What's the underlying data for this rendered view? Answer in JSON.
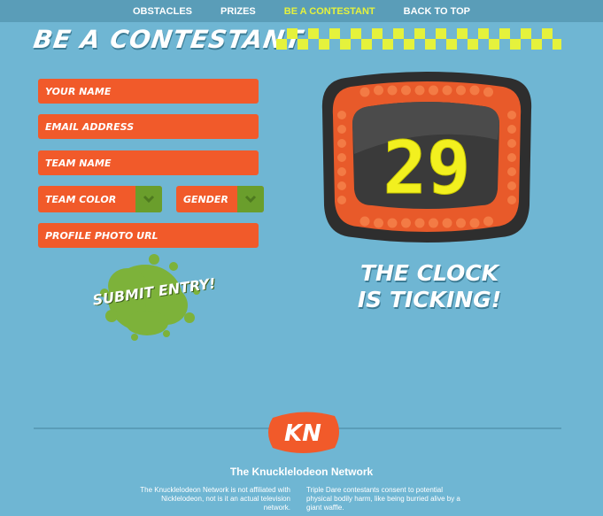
{
  "nav": {
    "items": [
      {
        "label": "OBSTACLES",
        "active": false
      },
      {
        "label": "PRIZES",
        "active": false
      },
      {
        "label": "BE A CONTESTANT",
        "active": true
      },
      {
        "label": "BACK TO TOP",
        "active": false
      }
    ]
  },
  "header": {
    "title": "BE A CONTESTANT"
  },
  "form": {
    "name_placeholder": "YOUR NAME",
    "email_placeholder": "EMAIL ADDRESS",
    "team_placeholder": "TEAM NAME",
    "team_color_label": "TEAM COLOR",
    "gender_label": "GENDER",
    "photo_placeholder": "PROFILE PHOTO URL",
    "submit_label": "SUBMIT ENTRY!"
  },
  "clock": {
    "value": "29",
    "caption_line1": "THE CLOCK",
    "caption_line2": "IS TICKING!"
  },
  "footer": {
    "logo_text": "KN",
    "network_name": "The Knucklelodeon Network",
    "disclaimer_left": "The Knucklelodeon Network is not affiliated with Nicklelodeon, not is it an actual television network.",
    "disclaimer_right": "Triple Dare contestants consent to potential physical bodily harm, like being burried alive by a giant waffle."
  },
  "colors": {
    "background": "#6fb6d3",
    "orange": "#f15a2a",
    "green": "#7db23a",
    "yellow": "#e5f23c"
  }
}
